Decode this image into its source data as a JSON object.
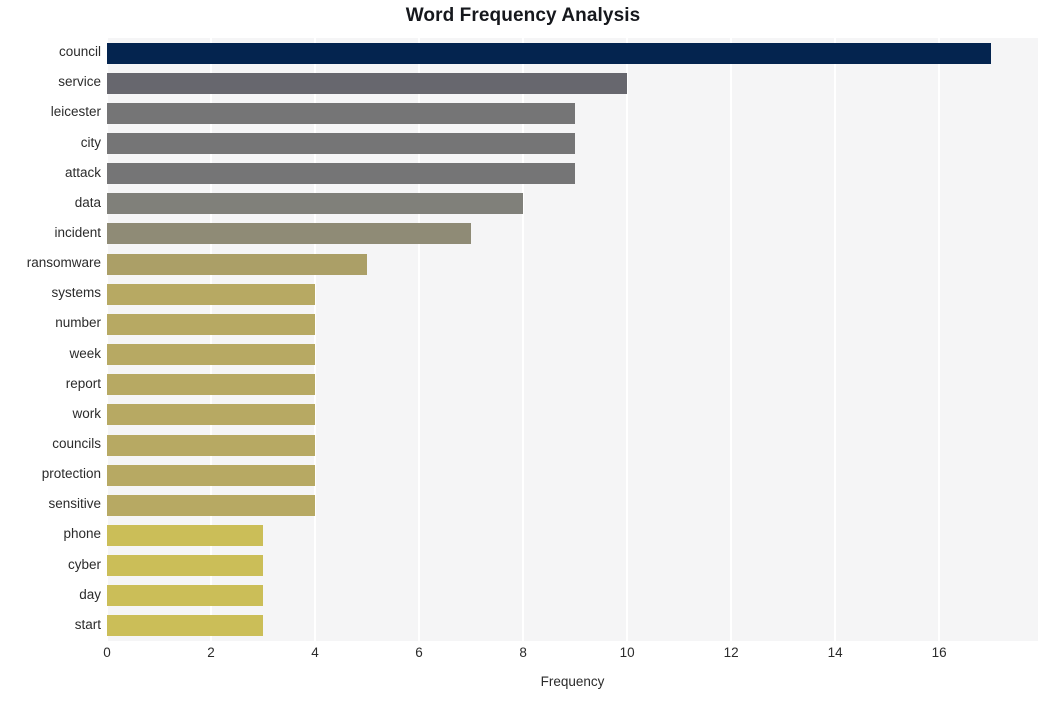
{
  "chart_data": {
    "type": "bar",
    "orientation": "horizontal",
    "title": "Word Frequency Analysis",
    "xlabel": "Frequency",
    "ylabel": "",
    "categories": [
      "council",
      "service",
      "leicester",
      "city",
      "attack",
      "data",
      "incident",
      "ransomware",
      "systems",
      "number",
      "week",
      "report",
      "work",
      "councils",
      "protection",
      "sensitive",
      "phone",
      "cyber",
      "day",
      "start"
    ],
    "values": [
      17,
      10,
      9,
      9,
      9,
      8,
      7,
      5,
      4,
      4,
      4,
      4,
      4,
      4,
      4,
      4,
      3,
      3,
      3,
      3
    ],
    "bar_colors": [
      "#04244f",
      "#67676e",
      "#757576",
      "#757576",
      "#757576",
      "#80807a",
      "#8f8b76",
      "#ab9f67",
      "#b7a963",
      "#b7a963",
      "#b7a963",
      "#b7a963",
      "#b7a963",
      "#b7a963",
      "#b7a963",
      "#b7a963",
      "#cbbe58",
      "#cbbe58",
      "#cbbe58",
      "#cbbe58"
    ],
    "xlim": [
      0,
      17.9
    ],
    "ylim": [
      0,
      20
    ],
    "xticks": [
      0,
      2,
      4,
      6,
      8,
      10,
      12,
      14,
      16
    ],
    "xtick_labels": [
      "0",
      "2",
      "4",
      "6",
      "8",
      "10",
      "12",
      "14",
      "16"
    ],
    "grid": true,
    "grid_axis": "x",
    "grid_color": "#ffffff",
    "legend": "none",
    "plot_background": "#f5f5f6",
    "figure_background": "#ffffff",
    "title_color": "#16181d",
    "tick_label_color": "#2b2b2b"
  }
}
